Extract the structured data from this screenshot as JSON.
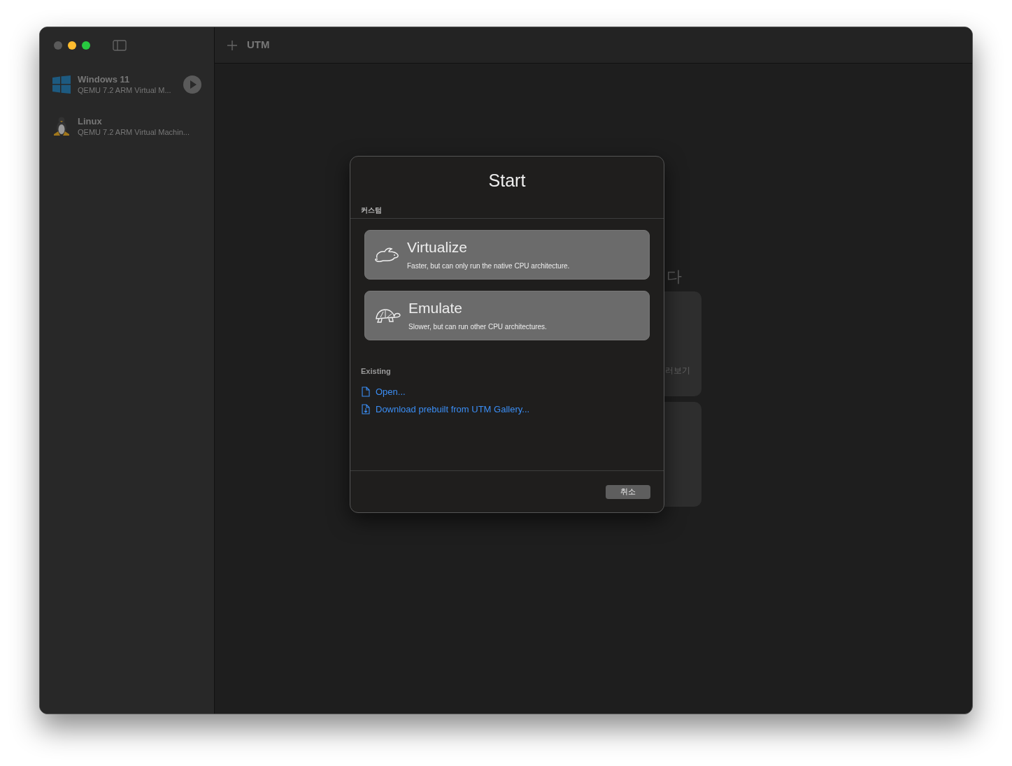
{
  "window": {
    "title": "UTM"
  },
  "sidebar": {
    "items": [
      {
        "kind": "windows",
        "name": "Windows 11",
        "subtitle": "QEMU 7.2 ARM Virtual M...",
        "selected": false,
        "play_button": true
      },
      {
        "kind": "linux",
        "name": "Linux",
        "subtitle": "QEMU 7.2 ARM Virtual Machin...",
        "selected": false,
        "play_button": false
      }
    ]
  },
  "background": {
    "heading": "다",
    "card_label": "러보기"
  },
  "dialog": {
    "title": "Start",
    "section": "커스텀",
    "options": [
      {
        "kind": "rabbit",
        "title": "Virtualize",
        "description": "Faster, but can only run the native CPU architecture."
      },
      {
        "kind": "turtle",
        "title": "Emulate",
        "description": "Slower, but can run other CPU architectures."
      }
    ],
    "existing_label": "Existing",
    "links": [
      {
        "kind": "file",
        "label": "Open..."
      },
      {
        "kind": "download",
        "label": "Download prebuilt from UTM Gallery..."
      }
    ],
    "cancel_button": "취소"
  }
}
